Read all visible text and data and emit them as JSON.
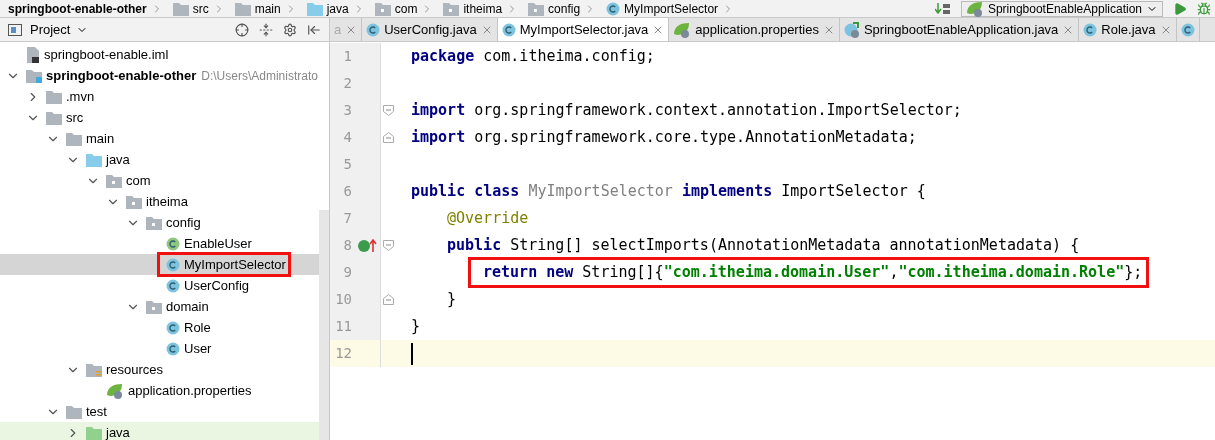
{
  "breadcrumb": [
    {
      "label": "springboot-enable-other",
      "kind": "module"
    },
    {
      "label": "src",
      "kind": "folder"
    },
    {
      "label": "main",
      "kind": "folder"
    },
    {
      "label": "java",
      "kind": "source"
    },
    {
      "label": "com",
      "kind": "package"
    },
    {
      "label": "itheima",
      "kind": "package"
    },
    {
      "label": "config",
      "kind": "package"
    },
    {
      "label": "MyImportSelector",
      "kind": "class"
    }
  ],
  "run_config": {
    "label": "SpringbootEnableApplication"
  },
  "project_panel": {
    "title": "Project",
    "tree": [
      {
        "label": "springboot-enable.iml",
        "kind": "iml",
        "selected": false,
        "highlighted": false
      },
      {
        "label": "springboot-enable-other",
        "path": "D:\\Users\\Administrato",
        "kind": "module",
        "expanded": true,
        "selected": false,
        "highlighted": false,
        "children": [
          {
            "label": ".mvn",
            "kind": "folder",
            "expanded": false,
            "selected": false,
            "highlighted": false
          },
          {
            "label": "src",
            "kind": "folder",
            "expanded": true,
            "selected": false,
            "highlighted": false,
            "children": [
              {
                "label": "main",
                "kind": "folder",
                "expanded": true,
                "selected": false,
                "highlighted": false,
                "children": [
                  {
                    "label": "java",
                    "kind": "source",
                    "expanded": true,
                    "selected": false,
                    "highlighted": false,
                    "children": [
                      {
                        "label": "com",
                        "kind": "package",
                        "expanded": true,
                        "selected": false,
                        "highlighted": false,
                        "children": [
                          {
                            "label": "itheima",
                            "kind": "package",
                            "expanded": true,
                            "selected": false,
                            "highlighted": false,
                            "children": [
                              {
                                "label": "config",
                                "kind": "package",
                                "expanded": true,
                                "selected": false,
                                "highlighted": false,
                                "children": [
                                  {
                                    "label": "EnableUser",
                                    "kind": "annotation",
                                    "selected": false,
                                    "highlighted": false
                                  },
                                  {
                                    "label": "MyImportSelector",
                                    "kind": "class",
                                    "selected": true,
                                    "highlighted": true
                                  },
                                  {
                                    "label": "UserConfig",
                                    "kind": "class",
                                    "selected": false,
                                    "highlighted": false
                                  }
                                ]
                              },
                              {
                                "label": "domain",
                                "kind": "package",
                                "expanded": true,
                                "selected": false,
                                "highlighted": false,
                                "children": [
                                  {
                                    "label": "Role",
                                    "kind": "class",
                                    "selected": false,
                                    "highlighted": false
                                  },
                                  {
                                    "label": "User",
                                    "kind": "class",
                                    "selected": false,
                                    "highlighted": false
                                  }
                                ]
                              }
                            ]
                          }
                        ]
                      }
                    ]
                  },
                  {
                    "label": "resources",
                    "kind": "resources",
                    "expanded": true,
                    "selected": false,
                    "highlighted": false,
                    "children": [
                      {
                        "label": "application.properties",
                        "kind": "properties",
                        "selected": false,
                        "highlighted": false
                      }
                    ]
                  }
                ]
              },
              {
                "label": "test",
                "kind": "folder",
                "expanded": true,
                "selected": false,
                "highlighted": false,
                "children": [
                  {
                    "label": "java",
                    "kind": "test-source",
                    "expanded": false,
                    "selected": false,
                    "highlighted": false
                  }
                ]
              }
            ]
          }
        ]
      }
    ]
  },
  "tabs": [
    {
      "label": "a",
      "kind": "fragment",
      "selected": false
    },
    {
      "label": "UserConfig.java",
      "kind": "class",
      "selected": false
    },
    {
      "label": "MyImportSelector.java",
      "kind": "class",
      "selected": true
    },
    {
      "label": "application.properties",
      "kind": "properties",
      "selected": false
    },
    {
      "label": "SpringbootEnableApplication.java",
      "kind": "spring-class",
      "selected": false
    },
    {
      "label": "Role.java",
      "kind": "class",
      "selected": false
    },
    {
      "kind": "class",
      "selected": false
    }
  ],
  "code": [
    {
      "number": "1",
      "kind": "plain",
      "current": false,
      "highlighted": false,
      "tokens": [
        {
          "kind": "keyword",
          "text": "package"
        },
        {
          "kind": "plain",
          "text": " com.itheima.config;"
        }
      ]
    },
    {
      "number": "2",
      "kind": "plain",
      "current": false,
      "highlighted": false
    },
    {
      "number": "3",
      "kind": "fold-start",
      "current": false,
      "highlighted": false,
      "tokens": [
        {
          "kind": "keyword",
          "text": "import"
        },
        {
          "kind": "plain",
          "text": " org.springframework.context.annotation.ImportSelector;"
        }
      ]
    },
    {
      "number": "4",
      "kind": "fold-end",
      "current": false,
      "highlighted": false,
      "tokens": [
        {
          "kind": "keyword",
          "text": "import"
        },
        {
          "kind": "plain",
          "text": " org.springframework.core.type.AnnotationMetadata;"
        }
      ]
    },
    {
      "number": "5",
      "kind": "plain",
      "current": false,
      "highlighted": false
    },
    {
      "number": "6",
      "kind": "plain",
      "current": false,
      "highlighted": false,
      "tokens": [
        {
          "kind": "keyword",
          "text": "public class "
        },
        {
          "kind": "unused",
          "text": "MyImportSelector"
        },
        {
          "kind": "keyword",
          "text": " implements"
        },
        {
          "kind": "plain",
          "text": " ImportSelector {"
        }
      ]
    },
    {
      "number": "7",
      "kind": "plain",
      "current": false,
      "highlighted": false,
      "tokens": [
        {
          "kind": "indent"
        },
        {
          "kind": "annotation",
          "text": "@Override"
        }
      ]
    },
    {
      "number": "8",
      "kind": "override",
      "current": false,
      "highlighted": false,
      "tokens": [
        {
          "kind": "indent"
        },
        {
          "kind": "keyword",
          "text": "public"
        },
        {
          "kind": "plain",
          "text": " String[] selectImports(AnnotationMetadata annotationMetadata) {"
        }
      ]
    },
    {
      "number": "9",
      "kind": "plain",
      "current": false,
      "highlighted": true,
      "tokens": [
        {
          "kind": "indent"
        },
        {
          "kind": "indent"
        },
        {
          "kind": "keyword",
          "text": "return new"
        },
        {
          "kind": "plain",
          "text": " String[]{"
        },
        {
          "kind": "string",
          "text": "\"com.itheima.domain.User\""
        },
        {
          "kind": "plain",
          "text": ","
        },
        {
          "kind": "string",
          "text": "\"com.itheima.domain.Role\""
        },
        {
          "kind": "plain",
          "text": "};"
        }
      ]
    },
    {
      "number": "10",
      "kind": "fold-end",
      "current": false,
      "highlighted": false,
      "tokens": [
        {
          "kind": "indent"
        },
        {
          "kind": "plain",
          "text": "}"
        }
      ]
    },
    {
      "number": "11",
      "kind": "plain",
      "current": false,
      "highlighted": false,
      "tokens": [
        {
          "kind": "plain",
          "text": "}"
        }
      ]
    },
    {
      "number": "12",
      "kind": "plain",
      "current": true,
      "highlighted": false
    }
  ]
}
